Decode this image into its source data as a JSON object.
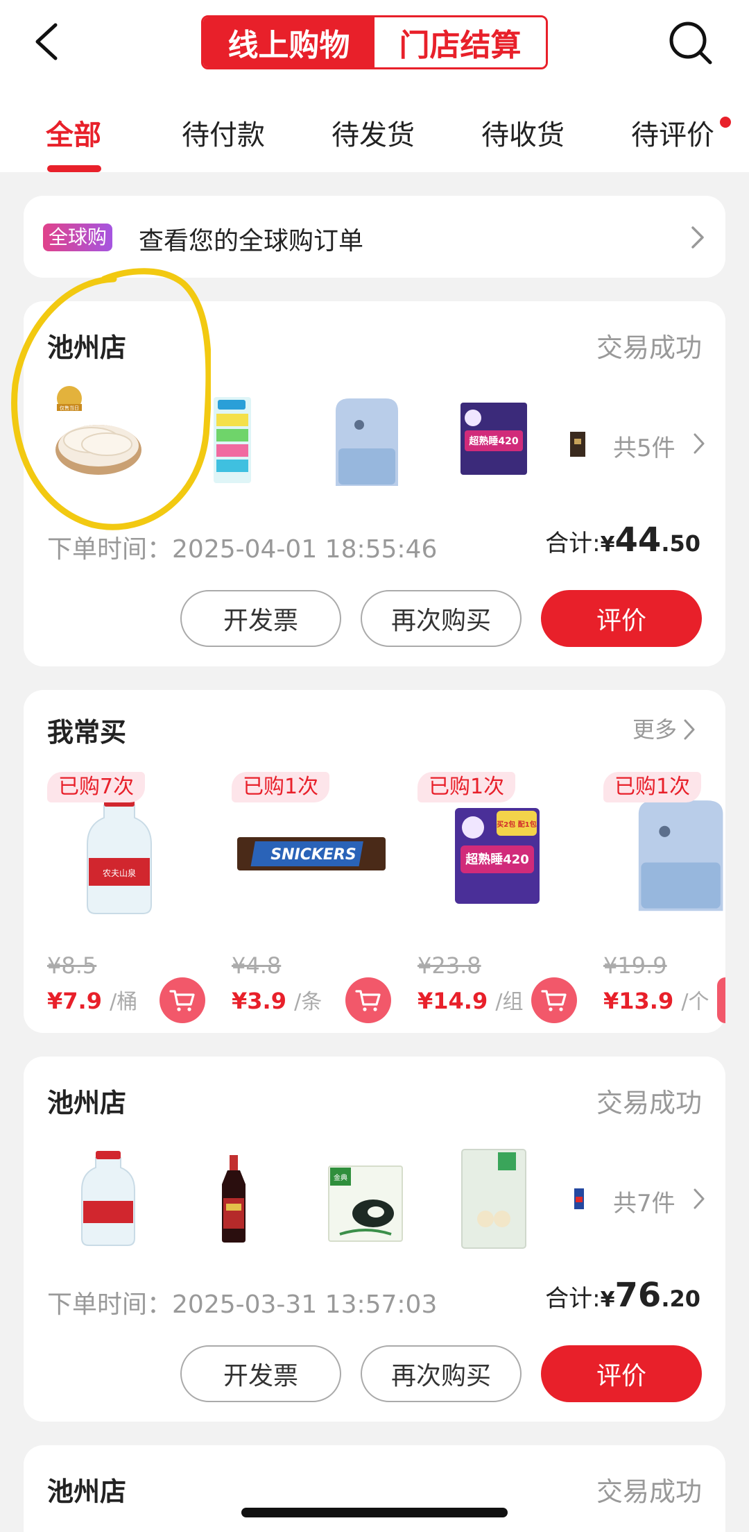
{
  "header": {
    "segments": [
      "线上购物",
      "门店结算"
    ]
  },
  "tabs": [
    {
      "label": "全部"
    },
    {
      "label": "待付款"
    },
    {
      "label": "待发货"
    },
    {
      "label": "待收货"
    },
    {
      "label": "待评价"
    }
  ],
  "global_order": {
    "badge": "全球购",
    "text": "查看您的全球购订单"
  },
  "orders": [
    {
      "store": "池州店",
      "status": "交易成功",
      "count": "共5件",
      "time_label": "下单时间：",
      "time": "2025-04-01 18:55:46",
      "total_label": "合计:",
      "currency": "¥",
      "total_int": "44",
      "total_dec": ".50",
      "buttons": [
        "开发票",
        "再次购买",
        "评价"
      ]
    },
    {
      "store": "池州店",
      "status": "交易成功",
      "count": "共7件",
      "time_label": "下单时间：",
      "time": "2025-03-31 13:57:03",
      "total_label": "合计:",
      "currency": "¥",
      "total_int": "76",
      "total_dec": ".20",
      "buttons": [
        "开发票",
        "再次购买",
        "评价"
      ]
    },
    {
      "store": "池州店",
      "status": "交易成功"
    }
  ],
  "frequent": {
    "title": "我常买",
    "more": "更多",
    "items": [
      {
        "bought": "已购7次",
        "orig": "¥8.5",
        "price": "¥7.9",
        "unit": "/桶"
      },
      {
        "bought": "已购1次",
        "orig": "¥4.8",
        "price": "¥3.9",
        "unit": "/条"
      },
      {
        "bought": "已购1次",
        "orig": "¥23.8",
        "price": "¥14.9",
        "unit": "/组"
      },
      {
        "bought": "已购1次",
        "orig": "¥19.9",
        "price": "¥13.9",
        "unit": "/个"
      }
    ]
  },
  "product_labels": {
    "snickers": "SNICKERS",
    "pad_big": "超熟睡420",
    "pad_promo": "买2包 配1包",
    "water_brand": "农夫山泉",
    "milk_brand": "金典",
    "fresh_badge": "仅售当日"
  }
}
